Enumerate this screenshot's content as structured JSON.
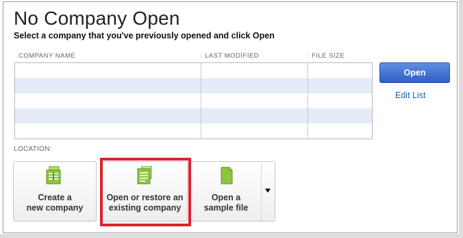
{
  "header": {
    "title": "No Company Open",
    "subtitle": "Select a company that you've previously opened and click Open"
  },
  "table": {
    "columns": [
      "COMPANY NAME",
      "LAST MODIFIED",
      "FILE SIZE"
    ],
    "rows": []
  },
  "actions": {
    "open_label": "Open",
    "edit_list_label": "Edit List"
  },
  "location": {
    "label": "LOCATION:"
  },
  "tiles": [
    {
      "line1": "Create a",
      "line2": "new company",
      "icon": "new-company-icon"
    },
    {
      "line1": "Open or restore an",
      "line2": "existing company",
      "icon": "open-company-icon"
    },
    {
      "line1": "Open a",
      "line2": "sample file",
      "icon": "sample-file-icon"
    }
  ],
  "colors": {
    "open_button": "#3a6ad0",
    "row_alt": "#e3ecf7",
    "highlight": "#d9232d",
    "icon_green": "#8cc63f"
  }
}
